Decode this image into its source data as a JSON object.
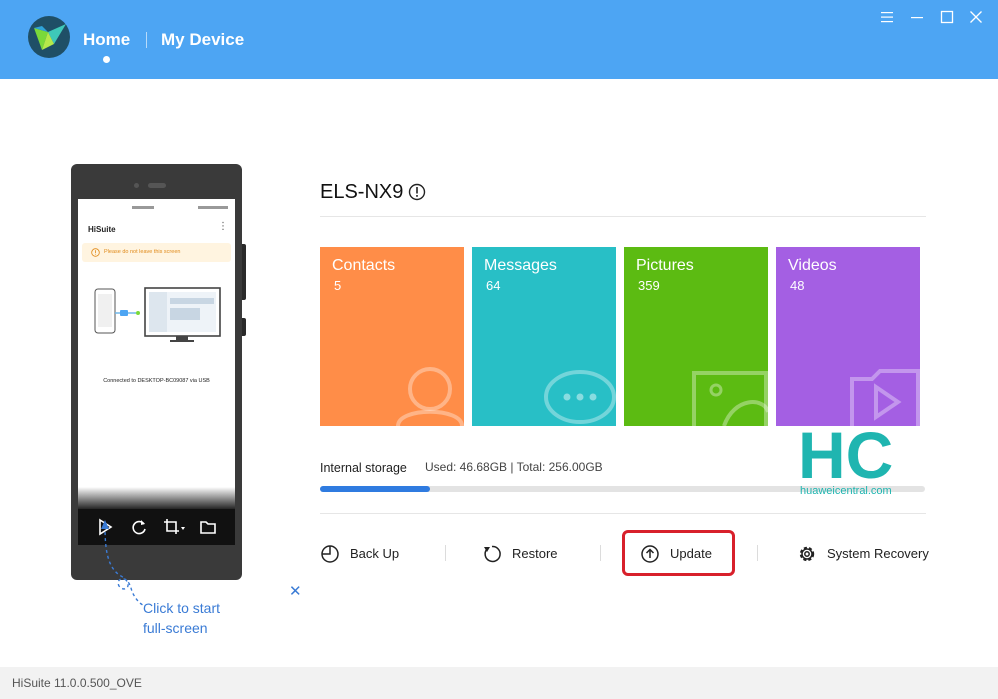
{
  "nav": {
    "home": "Home",
    "my_device": "My Device"
  },
  "window_controls": [
    "menu-icon",
    "minimize-icon",
    "maximize-icon",
    "close-icon"
  ],
  "phone_screen": {
    "app_title": "HiSuite",
    "warning": "Please do not leave this screen",
    "connection": "Connected to DESKTOP-BC09087 via USB",
    "controls": [
      "play-icon",
      "rotate-icon",
      "crop-icon",
      "folder-icon"
    ]
  },
  "fullscreen_hint": {
    "line1": "Click to start",
    "line2": "full-screen"
  },
  "device": {
    "name": "ELS-NX9"
  },
  "tiles": [
    {
      "title": "Contacts",
      "count": "5",
      "color": "#ff8d48",
      "icon": "contacts-icon"
    },
    {
      "title": "Messages",
      "count": "64",
      "color": "#28bfc6",
      "icon": "messages-icon"
    },
    {
      "title": "Pictures",
      "count": "359",
      "color": "#5cbb12",
      "icon": "pictures-icon"
    },
    {
      "title": "Videos",
      "count": "48",
      "color": "#a45fe3",
      "icon": "videos-icon"
    }
  ],
  "storage": {
    "label": "Internal storage",
    "used_text": "Used: 46.68GB | Total: 256.00GB",
    "used_fraction": 0.1823
  },
  "actions": [
    {
      "label": "Back Up",
      "icon": "backup-icon"
    },
    {
      "label": "Restore",
      "icon": "restore-icon"
    },
    {
      "label": "Update",
      "icon": "update-icon"
    },
    {
      "label": "System Recovery",
      "icon": "gear-icon"
    }
  ],
  "watermark": {
    "text": "HC",
    "site": "huaweicentral.com"
  },
  "footer": {
    "version": "HiSuite 11.0.0.500_OVE"
  },
  "colors": {
    "topbar": "#4da5f3",
    "accent": "#2f7be0",
    "highlight": "#d8202b"
  }
}
